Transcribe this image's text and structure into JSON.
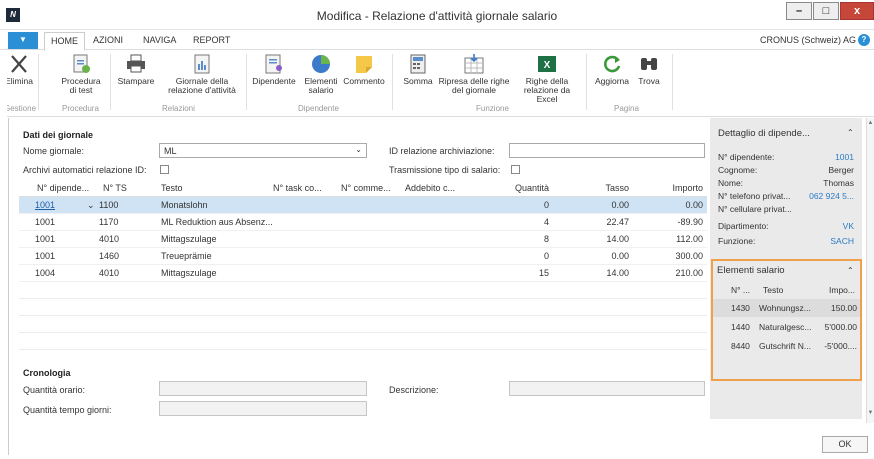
{
  "window": {
    "title": "Modifica - Relazione d'attività giornale salario",
    "minimize": "–",
    "maximize": "□",
    "close": "x"
  },
  "ribbon_tabs": {
    "menu": "▼",
    "tabs": [
      "HOME",
      "AZIONI",
      "NAVIGA",
      "REPORT"
    ],
    "company": "CRONUS (Schweiz) AG",
    "help": "?"
  },
  "ribbon": {
    "buttons": {
      "elimina": "Elimina",
      "procedura": "Procedura di test",
      "stampare": "Stampare",
      "giornale": "Giornale della relazione d'attività",
      "dipendente": "Dipendente",
      "elementi": "Elementi salario",
      "commento": "Commento",
      "somma": "Somma",
      "ripresa": "Ripresa delle righe del giornale",
      "righe_excel": "Righe della relazione da Excel",
      "aggiorna": "Aggiorna",
      "trova": "Trova"
    },
    "groups": {
      "gestione": "Gestione",
      "procedura": "Procedura",
      "relazioni": "Relazioni",
      "dipendente": "Dipendente",
      "funzione": "Funzione",
      "pagina": "Pagina"
    }
  },
  "header": {
    "section_title": "Dati dei giornale",
    "nome_giornale_label": "Nome giornale:",
    "nome_giornale_value": "ML",
    "archivi_label": "Archivi automatici relazione ID:",
    "id_relazione_label": "ID relazione archiviazione:",
    "id_relazione_value": "",
    "trasmissione_label": "Trasmissione tipo di salario:"
  },
  "grid": {
    "columns": [
      "N° dipende...",
      "N° TS",
      "Testo",
      "N° task co...",
      "N° comme...",
      "Addebito c...",
      "Quantità",
      "Tasso",
      "Importo"
    ],
    "rows": [
      {
        "dip": "1001",
        "ts": "1100",
        "testo": "Monatslohn",
        "qta": "0",
        "tasso": "0.00",
        "importo": "0.00"
      },
      {
        "dip": "1001",
        "ts": "1170",
        "testo": "ML Reduktion aus Absenz...",
        "qta": "4",
        "tasso": "22.47",
        "importo": "-89.90"
      },
      {
        "dip": "1001",
        "ts": "4010",
        "testo": "Mittagszulage",
        "qta": "8",
        "tasso": "14.00",
        "importo": "112.00"
      },
      {
        "dip": "1001",
        "ts": "1460",
        "testo": "Treueprämie",
        "qta": "0",
        "tasso": "0.00",
        "importo": "300.00"
      },
      {
        "dip": "1004",
        "ts": "4010",
        "testo": "Mittagszulage",
        "qta": "15",
        "tasso": "14.00",
        "importo": "210.00"
      }
    ]
  },
  "cronologia": {
    "section_title": "Cronologia",
    "quantita_orario_label": "Quantità orario:",
    "quantita_giorni_label": "Quantità tempo giorni:",
    "descrizione_label": "Descrizione:"
  },
  "factbox_dipendente": {
    "title": "Dettaglio di dipende...",
    "chevron": "⌃",
    "rows": [
      {
        "label": "N° dipendente:",
        "value": "1001",
        "link": true
      },
      {
        "label": "Cognome:",
        "value": "Berger",
        "link": false
      },
      {
        "label": "Nome:",
        "value": "Thomas",
        "link": false
      },
      {
        "label": "N° telefono privat...",
        "value": "062 924 5...",
        "link": true
      },
      {
        "label": "N° cellulare privat...",
        "value": "",
        "link": false
      },
      {
        "label": "Dipartimento:",
        "value": "VK",
        "link": true
      },
      {
        "label": "Funzione:",
        "value": "SACH",
        "link": true
      }
    ]
  },
  "factbox_elementi": {
    "title": "Elementi salario",
    "chevron": "⌃",
    "columns": [
      "N° ...",
      "Testo",
      "Impo..."
    ],
    "rows": [
      {
        "no": "1430",
        "testo": "Wohnungsz...",
        "importo": "150.00"
      },
      {
        "no": "1440",
        "testo": "Naturalgesc...",
        "importo": "5'000.00"
      },
      {
        "no": "8440",
        "testo": "Gutschrift N...",
        "importo": "-5'000...."
      }
    ]
  },
  "footer": {
    "ok": "OK"
  },
  "colors": {
    "accent": "#2b8fd6",
    "highlight_border": "#f0a04b",
    "selected_row": "#cfe3f5"
  }
}
